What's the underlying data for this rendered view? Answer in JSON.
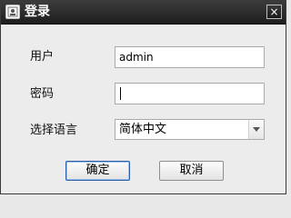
{
  "window": {
    "title": "登录",
    "close_label": "×"
  },
  "form": {
    "username_label": "用户",
    "username_value": "admin",
    "password_label": "密码",
    "password_value": "",
    "language_label": "选择语言",
    "language_value": "简体中文"
  },
  "buttons": {
    "ok_label": "确定",
    "cancel_label": "取消"
  },
  "icons": {
    "app": "app-icon",
    "close": "close-icon",
    "dropdown": "chevron-down-icon"
  },
  "colors": {
    "titlebar": "#2a2a2a",
    "background": "#ececec",
    "default_button_border": "#2b5ea8"
  }
}
